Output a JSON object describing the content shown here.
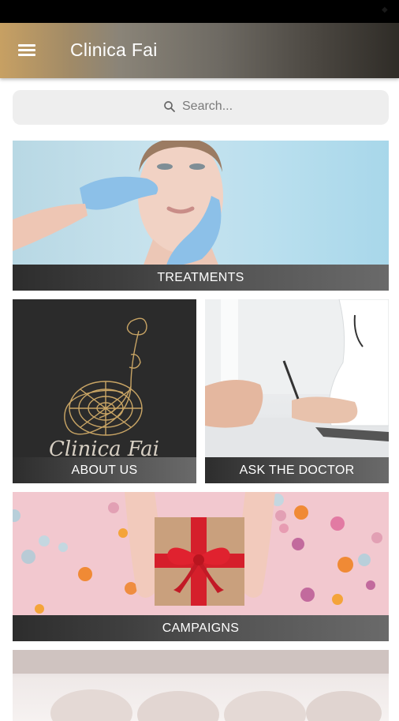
{
  "app": {
    "title": "Clinica Fai"
  },
  "colors": {
    "accent_gold": "#c7a063",
    "bar_dark": "#2d2d2d"
  },
  "icons": {
    "menu": "hamburger-menu-icon",
    "search": "magnifier-icon"
  },
  "search": {
    "placeholder": "Search..."
  },
  "tiles": [
    {
      "label": "TREATMENTS"
    },
    {
      "label": "ABOUT US"
    },
    {
      "label": "ASK THE DOCTOR"
    },
    {
      "label": "CAMPAIGNS"
    }
  ],
  "about": {
    "logo_text": "Clinica Fai"
  }
}
